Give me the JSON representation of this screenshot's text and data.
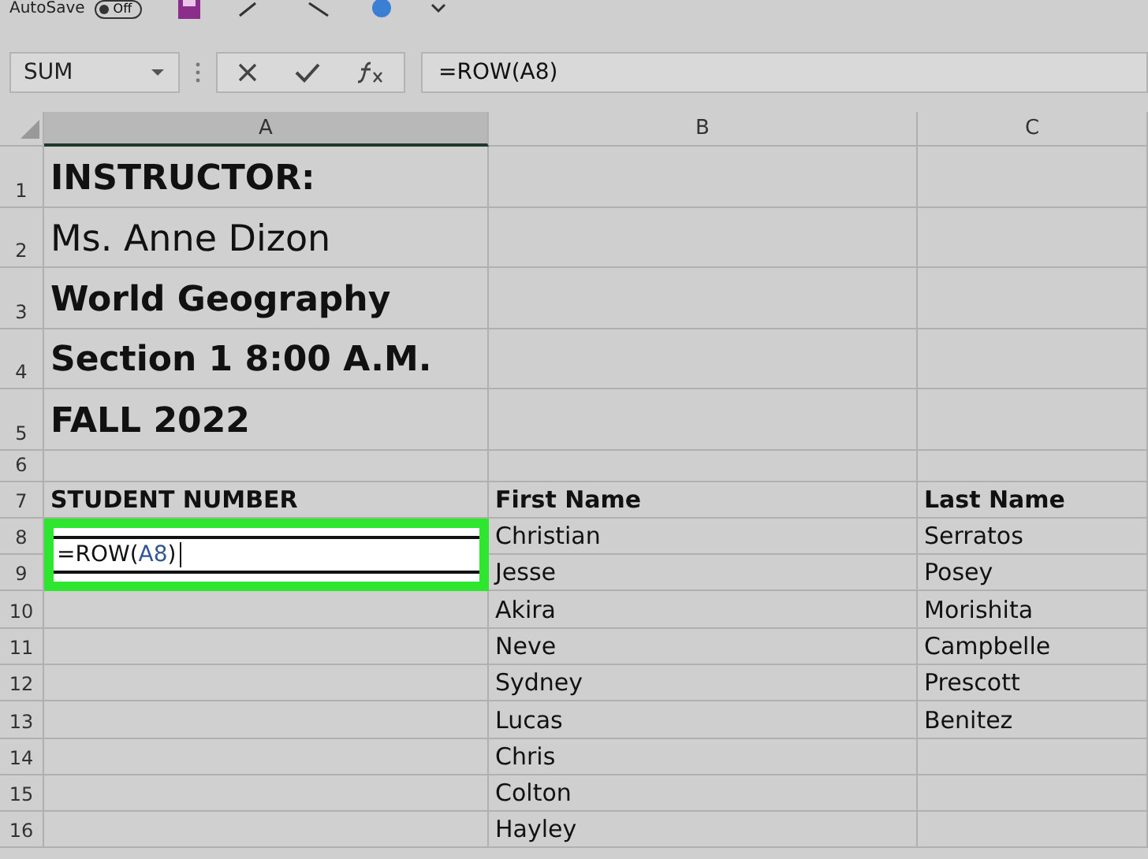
{
  "toolbar": {
    "autosave_label": "AutoSave",
    "autosave_toggle": {
      "label": "Off",
      "on": false
    }
  },
  "formula_bar": {
    "name_box": "SUM",
    "formula": "=ROW(A8)"
  },
  "columns": [
    {
      "label": "A",
      "selected": true
    },
    {
      "label": "B",
      "selected": false
    },
    {
      "label": "C",
      "selected": false
    }
  ],
  "rows": [
    {
      "number": "1",
      "kind": "title",
      "cells": [
        {
          "text": "INSTRUCTOR:",
          "bold": true
        },
        {
          "text": ""
        },
        {
          "text": ""
        }
      ]
    },
    {
      "number": "2",
      "kind": "title",
      "cells": [
        {
          "text": "Ms. Anne Dizon",
          "bold": false
        },
        {
          "text": ""
        },
        {
          "text": ""
        }
      ]
    },
    {
      "number": "3",
      "kind": "title",
      "cells": [
        {
          "text": "World Geography",
          "bold": true
        },
        {
          "text": ""
        },
        {
          "text": ""
        }
      ]
    },
    {
      "number": "4",
      "kind": "title",
      "cells": [
        {
          "text": "Section 1  8:00 A.M.",
          "bold": true
        },
        {
          "text": ""
        },
        {
          "text": ""
        }
      ]
    },
    {
      "number": "5",
      "kind": "title",
      "cells": [
        {
          "text": "FALL 2022",
          "bold": true
        },
        {
          "text": ""
        },
        {
          "text": ""
        }
      ]
    },
    {
      "number": "6",
      "kind": "spacer",
      "cells": [
        {
          "text": ""
        },
        {
          "text": ""
        },
        {
          "text": ""
        }
      ]
    },
    {
      "number": "7",
      "kind": "header",
      "cells": [
        {
          "text": "STUDENT NUMBER",
          "bold": true
        },
        {
          "text": "First Name",
          "bold": true
        },
        {
          "text": "Last Name",
          "bold": true
        }
      ]
    },
    {
      "number": "8",
      "kind": "data",
      "cells": [
        {
          "kind": "editor",
          "parts": [
            {
              "text": "=ROW(",
              "kind": "plain"
            },
            {
              "text": "A8",
              "kind": "ref"
            },
            {
              "text": ")",
              "kind": "plain"
            }
          ]
        },
        {
          "text": "Christian"
        },
        {
          "text": "Serratos"
        }
      ]
    },
    {
      "number": "9",
      "kind": "data",
      "cells": [
        {
          "text": ""
        },
        {
          "text": "Jesse"
        },
        {
          "text": "Posey"
        }
      ]
    },
    {
      "number": "10",
      "kind": "data",
      "cells": [
        {
          "text": ""
        },
        {
          "text": "Akira"
        },
        {
          "text": "Morishita"
        }
      ]
    },
    {
      "number": "11",
      "kind": "data",
      "cells": [
        {
          "text": ""
        },
        {
          "text": "Neve"
        },
        {
          "text": "Campbelle"
        }
      ]
    },
    {
      "number": "12",
      "kind": "data",
      "cells": [
        {
          "text": ""
        },
        {
          "text": "Sydney"
        },
        {
          "text": "Prescott"
        }
      ]
    },
    {
      "number": "13",
      "kind": "data",
      "cells": [
        {
          "text": ""
        },
        {
          "text": "Lucas"
        },
        {
          "text": "Benitez"
        }
      ]
    },
    {
      "number": "14",
      "kind": "data",
      "cells": [
        {
          "text": ""
        },
        {
          "text": "Chris"
        },
        {
          "text": ""
        }
      ]
    },
    {
      "number": "15",
      "kind": "data",
      "cells": [
        {
          "text": ""
        },
        {
          "text": "Colton"
        },
        {
          "text": ""
        }
      ]
    },
    {
      "number": "16",
      "kind": "data",
      "cells": [
        {
          "text": ""
        },
        {
          "text": "Hayley"
        },
        {
          "text": ""
        }
      ]
    }
  ]
}
